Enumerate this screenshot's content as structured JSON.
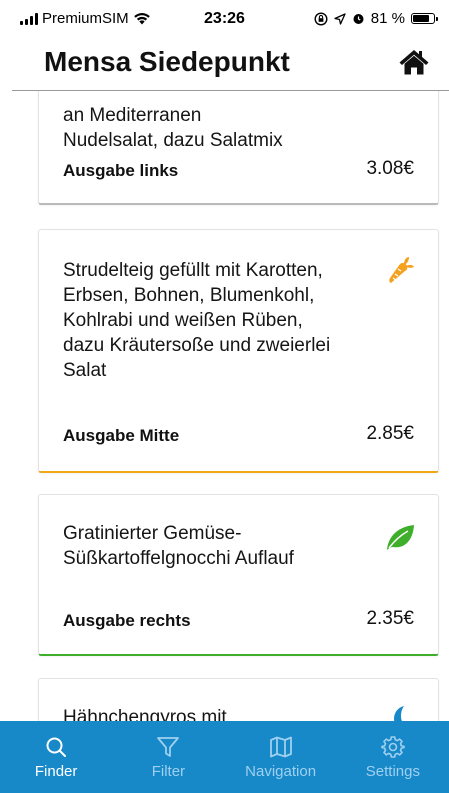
{
  "status_bar": {
    "carrier": "PremiumSIM",
    "time": "23:26",
    "battery": "81 %",
    "battery_level": 0.81
  },
  "header": {
    "title": "Mensa Siedepunkt"
  },
  "meals": [
    {
      "description_visible": "an Mediterranen Nudelsalat, dazu Salatmix",
      "location": "Ausgabe links",
      "price": "3.08€",
      "icon": "none",
      "accent_color": "#b9b9b9"
    },
    {
      "description": "Strudelteig gefüllt mit Karotten, Erbsen, Bohnen, Blumenkohl, Kohlrabi und weißen Rüben, dazu Kräutersoße und zweierlei Salat",
      "location": "Ausgabe Mitte",
      "price": "2.85€",
      "icon": "carrot-icon",
      "accent_color": "#f0a818"
    },
    {
      "description": "Gratinierter Gemüse-Süßkartoffelgnocchi Auflauf",
      "location": "Ausgabe rechts",
      "price": "2.35€",
      "icon": "leaf-icon",
      "accent_color": "#3fae2a"
    },
    {
      "description_visible": "Hähnchengyros mit",
      "icon": "moon-icon"
    }
  ],
  "tabbar": {
    "background": "#1788c8",
    "tabs": [
      {
        "label": "Finder",
        "icon": "search-icon",
        "active": true
      },
      {
        "label": "Filter",
        "icon": "filter-icon",
        "active": false
      },
      {
        "label": "Navigation",
        "icon": "map-icon",
        "active": false
      },
      {
        "label": "Settings",
        "icon": "gear-icon",
        "active": false
      }
    ]
  }
}
